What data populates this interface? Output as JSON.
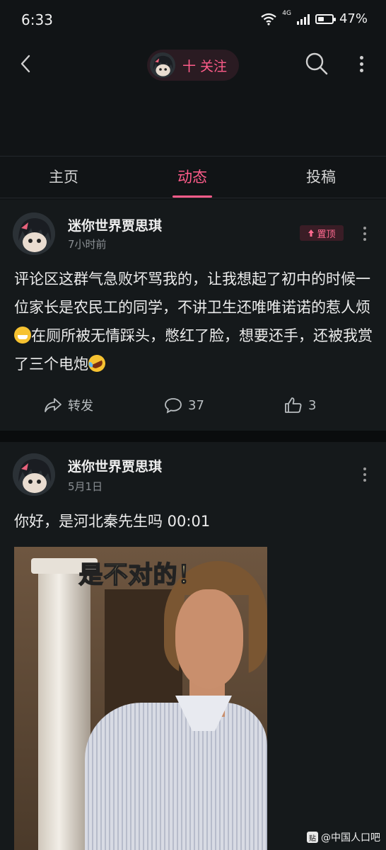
{
  "status": {
    "time": "6:33",
    "network": "4G",
    "battery_percent": "47%",
    "battery_level": 0.47
  },
  "header": {
    "follow_label": "十 关注"
  },
  "tabs": [
    {
      "label": "主页",
      "active": false
    },
    {
      "label": "动态",
      "active": true
    },
    {
      "label": "投稿",
      "active": false
    }
  ],
  "posts": [
    {
      "author": "迷你世界贾思琪",
      "time": "7小时前",
      "pinned_label": "置顶",
      "text_parts": [
        "评论区这群气急败坏骂我的，让我想起了初中的时候一位家长是农民工的同学，不讲卫生还唯唯诺诺的惹人烦",
        "在厕所被无情踩头，憋红了脸，想要还手，还被我赏了三个电炮"
      ],
      "emojis": [
        "grinning-emoji",
        "rofl-emoji"
      ],
      "actions": {
        "share_label": "转发",
        "comment_count": "37",
        "like_count": "3"
      }
    },
    {
      "author": "迷你世界贾思琪",
      "time": "5月1日",
      "text": "你好，是河北秦先生吗 00:01",
      "media_caption": "是不对的！"
    }
  ],
  "watermark": {
    "text": "@中国人口吧",
    "icon_text": "贴"
  },
  "colors": {
    "accent": "#ff5c8a",
    "background": "#111416"
  }
}
